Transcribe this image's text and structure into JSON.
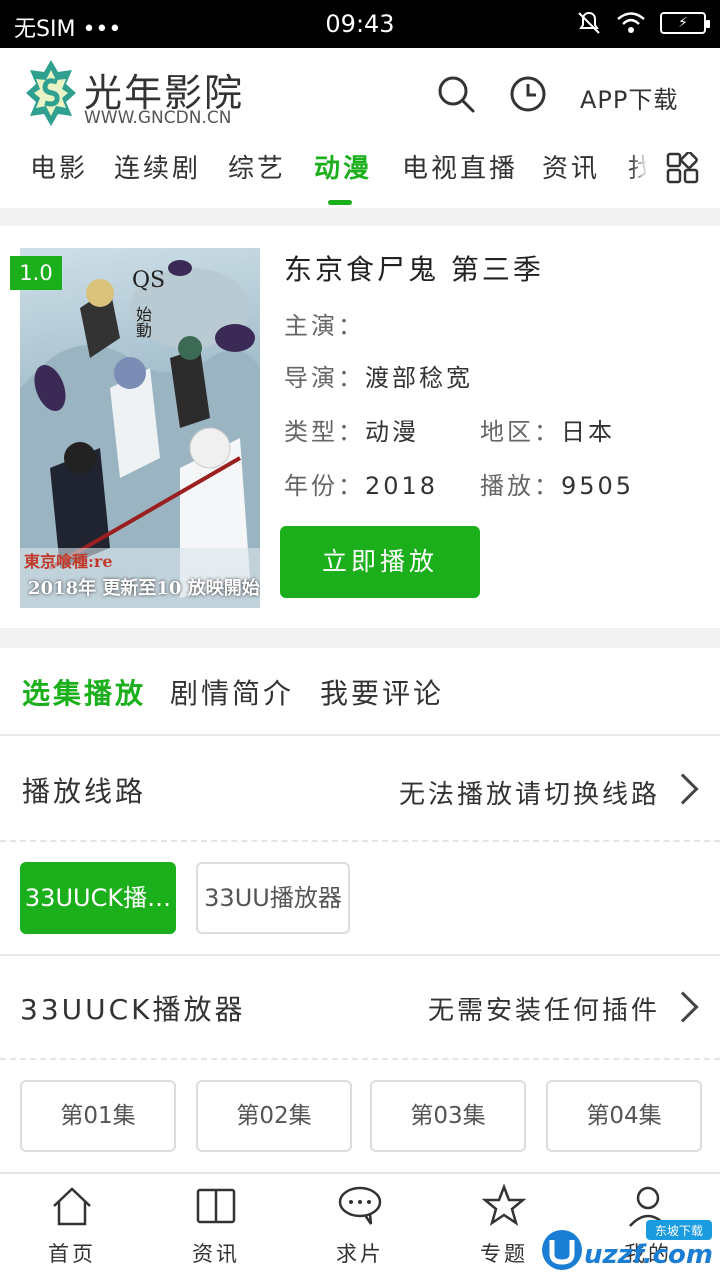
{
  "status": {
    "carrier": "无SIM",
    "dots": "•••",
    "time": "09:43"
  },
  "header": {
    "site_name": "光年影院",
    "site_url": "WWW.GNCDN.CN",
    "app_download": "APP下载"
  },
  "nav": {
    "items": [
      "电影",
      "连续剧",
      "综艺",
      "动漫",
      "电视直播",
      "资讯",
      "找"
    ],
    "active": "动漫"
  },
  "detail": {
    "rating": "1.0",
    "title": "东京食尸鬼 第三季",
    "actor_label": "主演：",
    "actor_value": "",
    "director_label": "导演：",
    "director_value": "渡部稔宽",
    "genre_label": "类型：",
    "genre_value": "动漫",
    "region_label": "地区：",
    "region_value": "日本",
    "year_label": "年份：",
    "year_value": "2018",
    "plays_label": "播放：",
    "plays_value": "9505",
    "play_button": "立即播放",
    "poster_text_1": "東京喰種:re",
    "poster_text_2": "2018年",
    "poster_text_3": "更新至10",
    "poster_text_4": "放映開始",
    "poster_text_5": "QS",
    "poster_text_6": "始動"
  },
  "tabs": {
    "items": [
      "选集播放",
      "剧情简介",
      "我要评论"
    ],
    "active": "选集播放"
  },
  "lines": {
    "label": "播放线路",
    "hint": "无法播放请切换线路"
  },
  "sources": [
    "33UUCK播…",
    "33UU播放器"
  ],
  "player": {
    "label": "33UUCK播放器",
    "hint": "无需安装任何插件"
  },
  "episodes": [
    "第01集",
    "第02集",
    "第03集",
    "第04集"
  ],
  "bottom_nav": [
    "首页",
    "资讯",
    "求片",
    "专题",
    "我的"
  ],
  "watermark": {
    "text": "uzzf.com",
    "badge": "东坡下载"
  },
  "colors": {
    "accent": "#1bb01b"
  }
}
